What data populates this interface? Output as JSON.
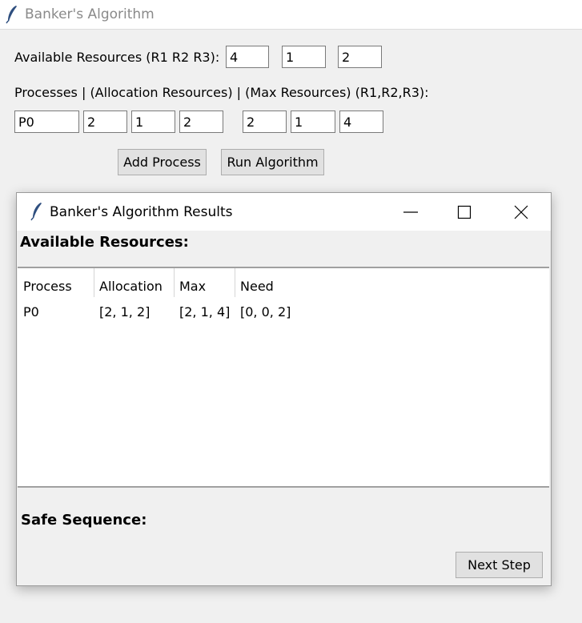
{
  "window": {
    "title": "Banker's Algorithm",
    "icon": "feather-icon"
  },
  "available": {
    "label": "Available Resources (R1 R2 R3):",
    "values": [
      "4",
      "1",
      "2"
    ]
  },
  "processes": {
    "label": "Processes | (Allocation Resources)   |   (Max Resources) (R1,R2,R3):",
    "name_value": "P0",
    "allocation_values": [
      "2",
      "1",
      "2"
    ],
    "max_values": [
      "2",
      "1",
      "4"
    ]
  },
  "buttons": {
    "add_process": "Add Process",
    "run_algorithm": "Run Algorithm"
  },
  "results": {
    "title": "Banker's Algorithm Results",
    "icon": "feather-icon",
    "controls": [
      "minimize-icon",
      "maximize-icon",
      "close-icon"
    ],
    "available_label": "Available Resources:",
    "table": {
      "columns": [
        "Process",
        "Allocation",
        "Max",
        "Need"
      ],
      "rows": [
        {
          "process": "P0",
          "allocation": "[2, 1, 2]",
          "max": "[2, 1, 4]",
          "need": "[0, 0, 2]"
        }
      ]
    },
    "safe_sequence_label": "Safe Sequence:",
    "next_step": "Next Step"
  }
}
